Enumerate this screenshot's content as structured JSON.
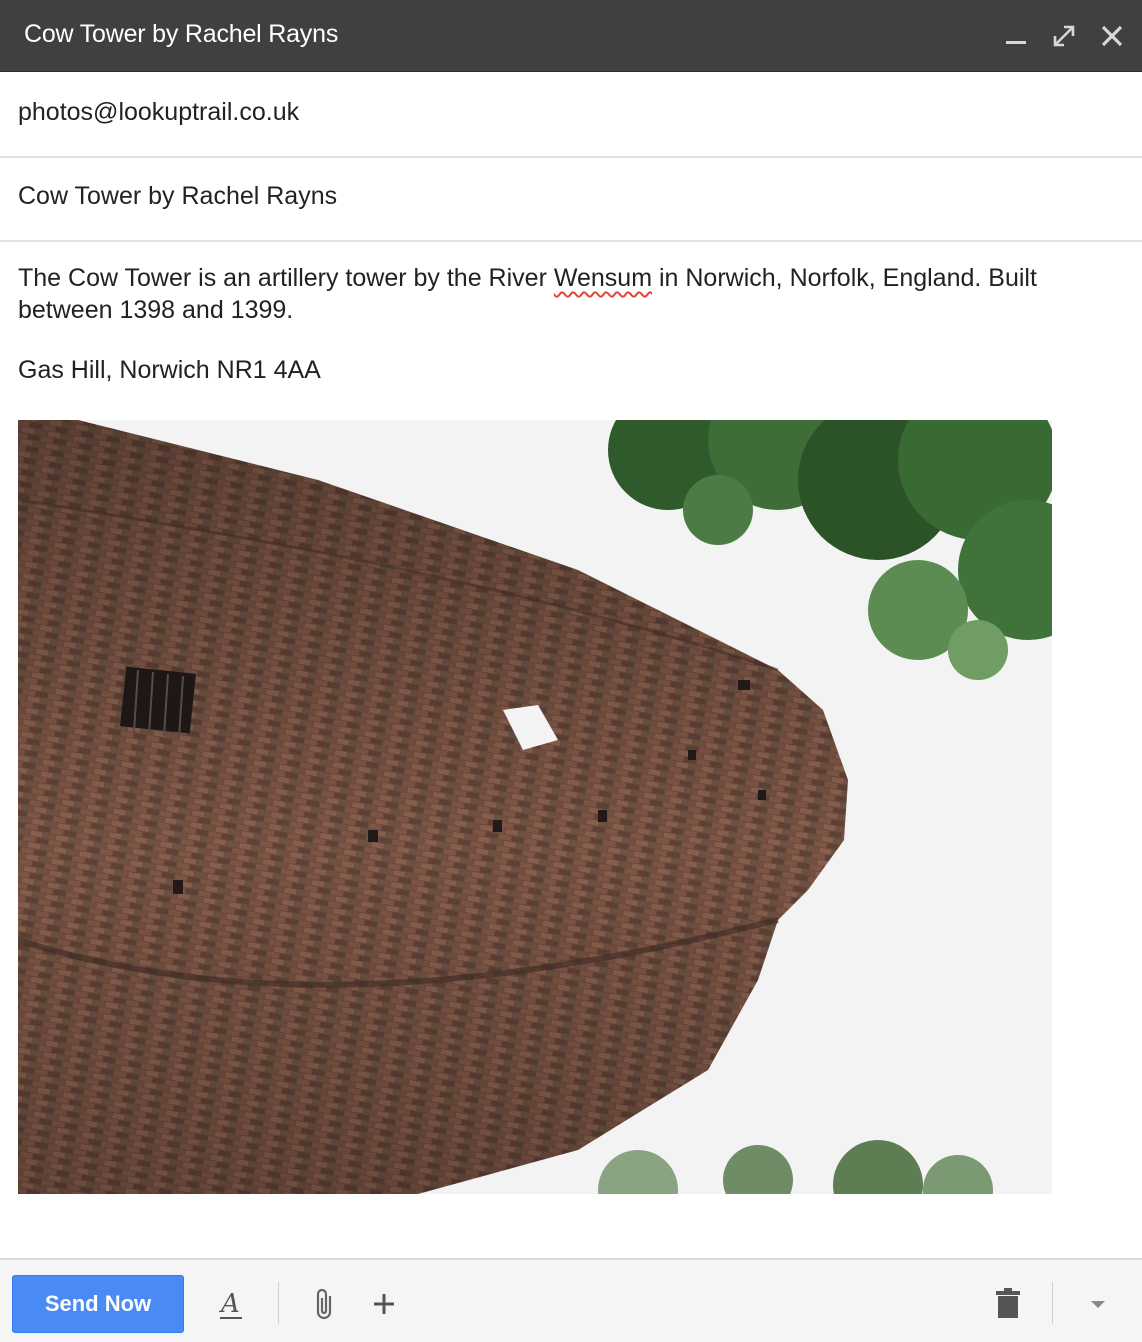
{
  "window": {
    "title": "Cow Tower by Rachel Rayns",
    "controls": [
      "minimize-icon",
      "expand-icon",
      "close-icon"
    ]
  },
  "to": {
    "value": "photos@lookuptrail.co.uk"
  },
  "subject": {
    "value": "Cow Tower by Rachel Rayns"
  },
  "body": {
    "line1_before": "The Cow Tower is an artillery tower by the River ",
    "misspelled": "Wensum",
    "line1_after": " in Norwich, Norfolk, England. Built between 1398 and 1399.",
    "address": "Gas Hill, Norwich NR1 4AA"
  },
  "footer": {
    "send_label": "Send Now",
    "tools": [
      "text-format-icon",
      "attach-icon",
      "more-options-icon",
      "trash-icon",
      "dropdown-icon"
    ]
  },
  "colors": {
    "titlebar": "#404040",
    "send_button": "#4a8af4",
    "footer_bg": "#f5f5f5"
  }
}
